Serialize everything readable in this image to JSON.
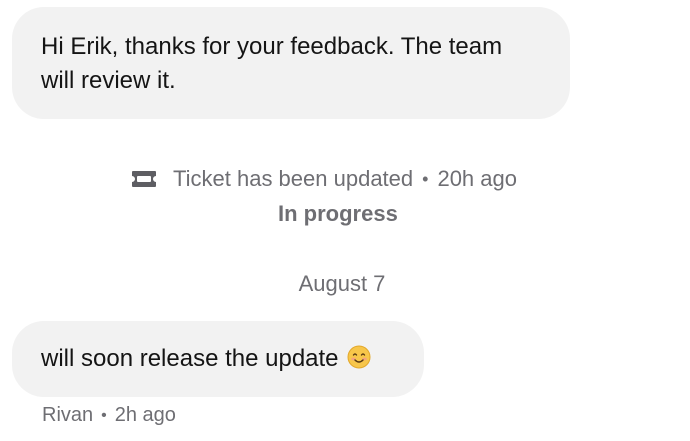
{
  "messages": [
    {
      "text": "Hi Erik, thanks for your feedback. The team will review it."
    },
    {
      "text": "will soon release the update",
      "emoji_icon": "smiling-face-emoji",
      "sender": "Rivan",
      "time": "2h ago"
    }
  ],
  "ticket_update": {
    "icon": "ticket-icon",
    "text": "Ticket has been updated",
    "time": "20h ago",
    "status": "In progress"
  },
  "date_divider": "August 7",
  "separator": "•",
  "colors": {
    "bubble_background": "#f2f2f2",
    "meta_text": "#6e6e73",
    "message_text": "#151515"
  }
}
